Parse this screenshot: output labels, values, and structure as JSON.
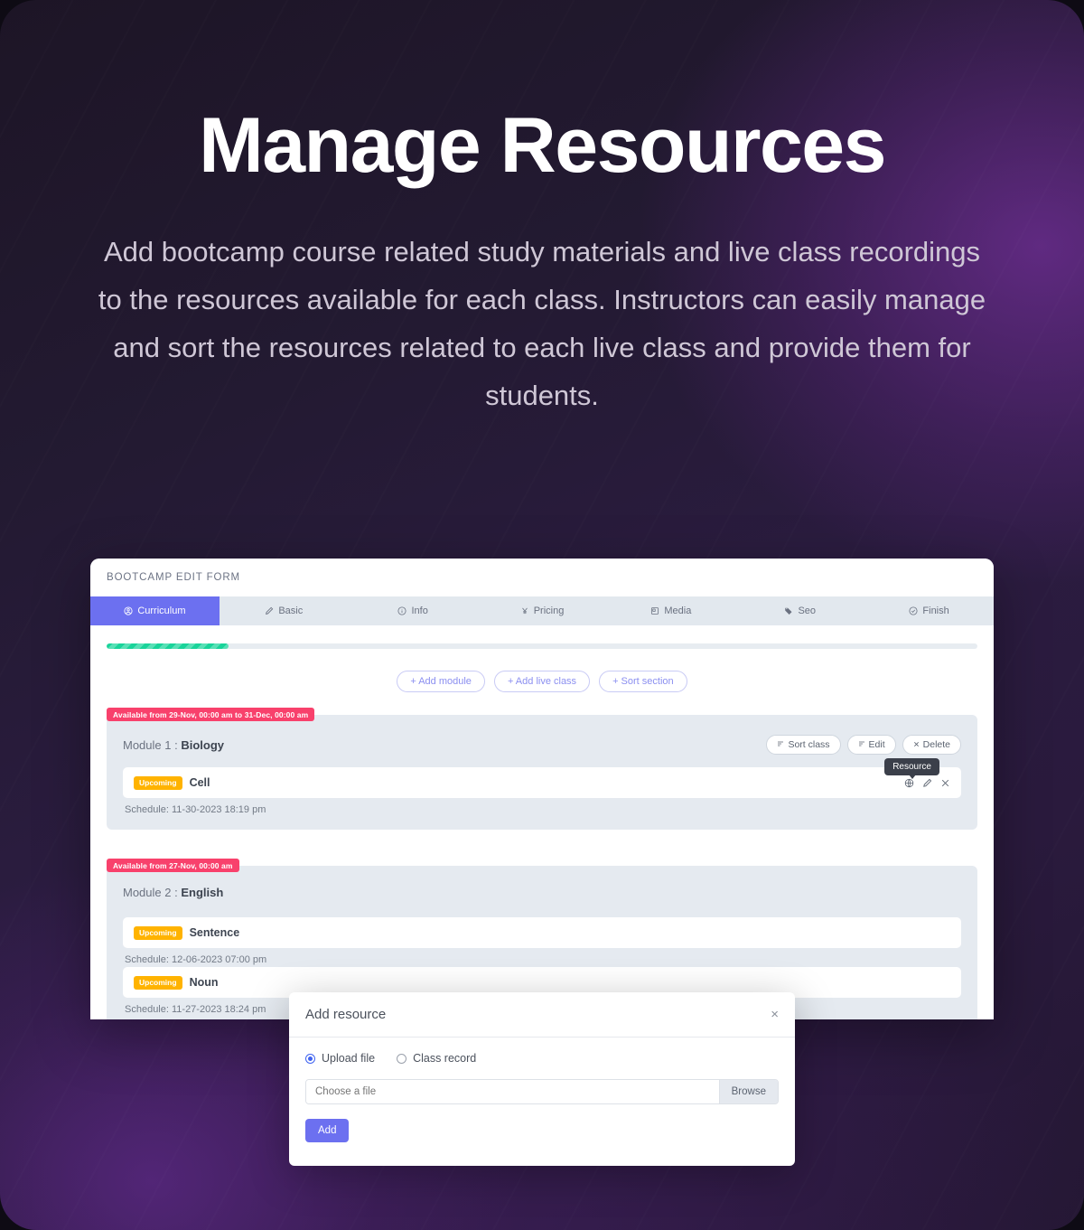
{
  "hero": {
    "title": "Manage Resources",
    "subtitle": "Add bootcamp course related study materials and live class recordings to the resources available for each class. Instructors can easily manage and sort the resources related to each live class and provide them for students."
  },
  "colors": {
    "accent": "#6c70f0",
    "progress": "#19d49a",
    "badge_available": "#f8416c",
    "badge_upcoming": "#ffb300",
    "tab_bar": "#e2e8ee",
    "module_card": "#e5eaf0"
  },
  "app": {
    "header_title": "BOOTCAMP EDIT FORM",
    "tabs": [
      {
        "label": "Curriculum",
        "icon": "user-circle-icon",
        "active": true
      },
      {
        "label": "Basic",
        "icon": "pen-icon",
        "active": false
      },
      {
        "label": "Info",
        "icon": "info-circle-icon",
        "active": false
      },
      {
        "label": "Pricing",
        "icon": "yen-icon",
        "active": false
      },
      {
        "label": "Media",
        "icon": "image-icon",
        "active": false
      },
      {
        "label": "Seo",
        "icon": "tag-icon",
        "active": false
      },
      {
        "label": "Finish",
        "icon": "check-circle-icon",
        "active": false
      }
    ],
    "progress_percent": 14,
    "toolbar": [
      {
        "label": "+ Add module"
      },
      {
        "label": "+ Add live class"
      },
      {
        "label": "+ Sort section"
      }
    ],
    "modules": [
      {
        "availability": "Available from 29-Nov, 00:00 am to 31-Dec, 00:00 am",
        "title_prefix": "Module 1 : ",
        "title_name": "Biology",
        "actions": [
          {
            "label": "Sort class",
            "icon": "sort-icon"
          },
          {
            "label": "Edit",
            "icon": "sort-icon"
          },
          {
            "label": "Delete",
            "icon": "close-icon"
          }
        ],
        "tooltip": "Resource",
        "classes": [
          {
            "status": "Upcoming",
            "name": "Cell",
            "schedule": "Schedule: 11-30-2023 18:19 pm",
            "show_icons": true
          }
        ]
      },
      {
        "availability": "Available from 27-Nov, 00:00 am",
        "title_prefix": "Module 2 : ",
        "title_name": "English",
        "actions": [],
        "tooltip": "",
        "classes": [
          {
            "status": "Upcoming",
            "name": "Sentence",
            "schedule": "Schedule: 12-06-2023 07:00 pm",
            "show_icons": false
          },
          {
            "status": "Upcoming",
            "name": "Noun",
            "schedule": "Schedule: 11-27-2023 18:24 pm",
            "show_icons": false
          }
        ]
      }
    ]
  },
  "modal": {
    "title": "Add resource",
    "close_label": "×",
    "options": [
      {
        "label": "Upload file",
        "checked": true
      },
      {
        "label": "Class record",
        "checked": false
      }
    ],
    "file_placeholder": "Choose a file",
    "file_value": "",
    "browse_label": "Browse",
    "submit_label": "Add"
  }
}
